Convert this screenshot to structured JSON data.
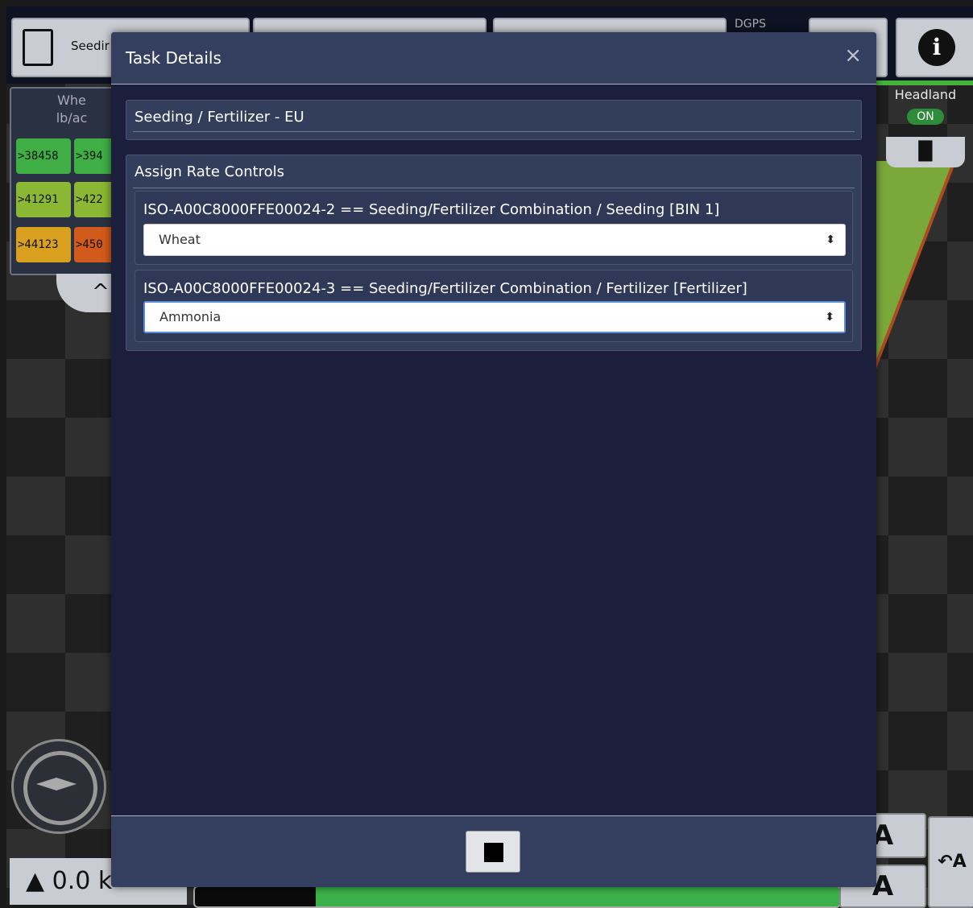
{
  "background": {
    "task_button_label": "Seedir",
    "gps_status": "DGPS",
    "wheat_panel": {
      "title": "Whe",
      "unit": "lb/ac"
    },
    "legend": [
      {
        "label": ">38458",
        "color": "#3fae45"
      },
      {
        "label": ">394",
        "color": "#3fae45"
      },
      {
        "label": ">41291",
        "color": "#8ab834"
      },
      {
        "label": ">422",
        "color": "#8ab834"
      },
      {
        "label": ">44123",
        "color": "#d9a020"
      },
      {
        "label": ">450",
        "color": "#d25a1a"
      }
    ],
    "headland": {
      "label": "Headland",
      "status": "ON"
    },
    "speed": "0.0 k",
    "right_buttons": {
      "top": "A",
      "bottom": "A",
      "side": "↶A"
    }
  },
  "modal": {
    "title": "Task Details",
    "close_label": "×",
    "task_name": "Seeding / Fertilizer - EU",
    "assign_title": "Assign Rate Controls",
    "controls": [
      {
        "label": "ISO-A00C8000FFE00024-2 == Seeding/Fertilizer Combination / Seeding [BIN 1]",
        "value": "Wheat"
      },
      {
        "label": "ISO-A00C8000FFE00024-3 == Seeding/Fertilizer Combination / Fertilizer [Fertilizer]",
        "value": "Ammonia"
      }
    ]
  }
}
